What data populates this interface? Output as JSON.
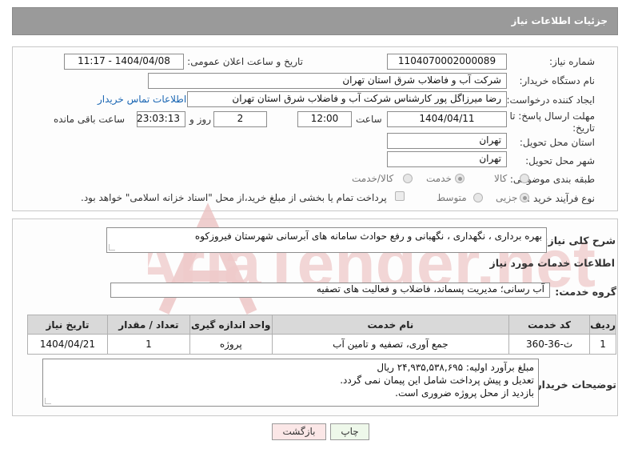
{
  "header": {
    "title": "جزئیات اطلاعات نیاز"
  },
  "info": {
    "need_number_label": "شماره نیاز:",
    "need_number": "1104070002000089",
    "announce_label": "تاریخ و ساعت اعلان عمومی:",
    "announce_value": "1404/04/08 - 11:17",
    "buyer_org_label": "نام دستگاه خریدار:",
    "buyer_org": "شرکت آب و فاضلاب شرق استان تهران",
    "creator_label": "ایجاد کننده درخواست:",
    "creator": "رضا میرزاگل پور کارشناس شرکت آب و فاضلاب شرق استان تهران",
    "contact_link": "اطلاعات تماس خریدار",
    "deadline_label_1": "مهلت ارسال پاسخ: تا",
    "deadline_label_2": "تاریخ:",
    "deadline_date": "1404/04/11",
    "time_label": "ساعت",
    "deadline_time": "12:00",
    "days_value": "2",
    "days_label": "روز و",
    "remaining_time": "23:03:13",
    "remaining_label": "ساعت باقی مانده",
    "province_label": "استان محل تحویل:",
    "province": "تهران",
    "city_label": "شهر محل تحویل:",
    "city": "تهران",
    "category_label": "طبقه بندی موضوعی:",
    "category_options": [
      "کالا",
      "خدمت",
      "کالا/خدمت"
    ],
    "category_selected": "خدمت",
    "process_label": "نوع فرآیند خرید :",
    "process_options": [
      "جزیی",
      "متوسط"
    ],
    "process_selected": "جزیی",
    "treasury_text": "پرداخت تمام یا بخشی از مبلغ خرید،از محل \"اسناد خزانه اسلامی\" خواهد بود."
  },
  "details": {
    "summary_label": "شرح کلی نیاز:",
    "summary": "بهره برداری ، نگهداری ، نگهبانی و رفع حوادث سامانه های آبرسانی شهرستان فیروزکوه",
    "services_heading": "اطلاعات خدمات مورد نیاز",
    "group_label": "گروه خدمت:",
    "group_value": "آب رسانی؛ مدیریت پسماند، فاضلاب و فعالیت های تصفیه",
    "table": {
      "headers": [
        "ردیف",
        "کد خدمت",
        "نام خدمت",
        "واحد اندازه گیری",
        "تعداد / مقدار",
        "تاریخ نیاز"
      ],
      "rows": [
        [
          "1",
          "ث-36-360",
          "جمع آوری، تصفیه و تامین آب",
          "پروژه",
          "1",
          "1404/04/21"
        ]
      ]
    },
    "buyer_notes_label": "توضیحات خریدار:",
    "buyer_notes": [
      "مبلغ برآورد اولیه: ۲۴,۹۳۵,۵۳۸,۶۹۵ ریال",
      "تعدیل و پیش پرداخت شامل این پیمان نمی گردد.",
      "بازدید از محل پروژه ضروری است."
    ]
  },
  "buttons": {
    "print": "چاپ",
    "back": "بازگشت"
  },
  "watermark": "AriaTender.net",
  "colors": {
    "header": "#9a9a9a",
    "link": "#1a66b3",
    "watermark": "#e9b9b9"
  }
}
